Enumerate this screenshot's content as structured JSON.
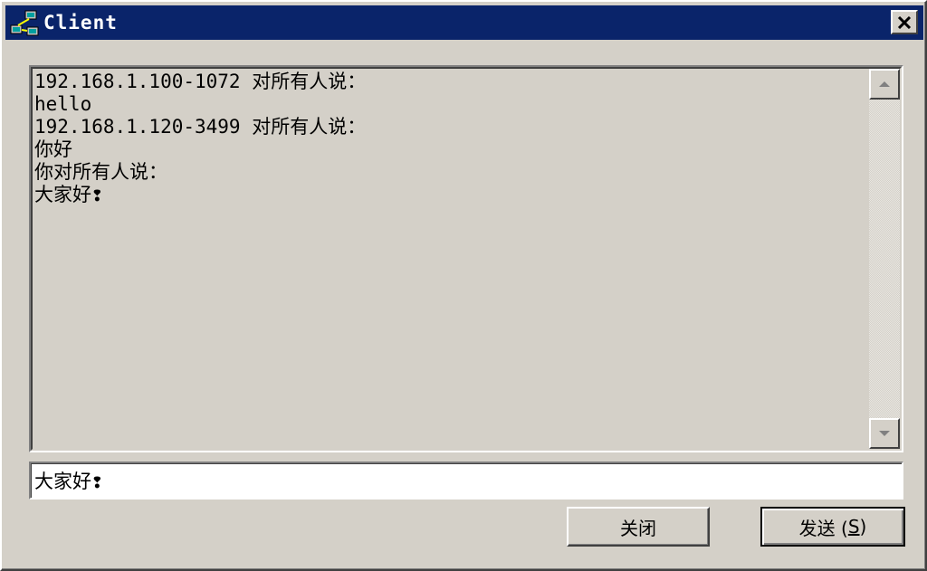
{
  "window": {
    "title": "Client"
  },
  "titlebar": {
    "icon": "network-computers-icon",
    "close_glyph": "close-icon"
  },
  "chat": {
    "lines": [
      "192.168.1.100-1072 对所有人说：",
      "hello",
      "192.168.1.120-3499 对所有人说：",
      "你好",
      "你对所有人说：",
      "大家好❢"
    ]
  },
  "input": {
    "value": "大家好❢"
  },
  "buttons": {
    "close_label": "关闭",
    "send_label_prefix": "发送 (",
    "send_mnemonic": "S",
    "send_label_suffix": ")"
  }
}
